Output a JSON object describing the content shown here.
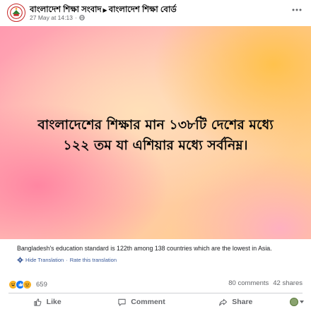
{
  "post": {
    "page_name": "বাংলাদেশ শিক্ষা সংবাদ",
    "group_name": "বাংলাদেশ শিক্ষা বোর্ড",
    "timestamp": "27 May at 14:13",
    "separator": "·",
    "image_text_line1": "বাংলাদেশের শিক্ষার মান ১৩৮টি দেশের মধ্যে",
    "image_text_line2": "১২২ তম যা এশিয়ার মধ্যে সর্বনিম্ন।",
    "translation": "Bangladesh's education standard is 122th among 138 countries which are the lowest in Asia.",
    "hide_translation": "Hide Translation",
    "rate_translation": "Rate this translation",
    "link_separator": "·"
  },
  "engagement": {
    "reaction_count": "659",
    "comments": "80 comments",
    "shares": "42 shares",
    "reaction_icons": [
      "haha-icon",
      "like-icon",
      "sad-icon"
    ]
  },
  "actions": {
    "like": "Like",
    "comment": "Comment",
    "share": "Share"
  },
  "colors": {
    "link": "#385898",
    "like_blue": "#1877f2",
    "reaction_yellow": "#f7b125",
    "muted_text": "#65676b"
  }
}
